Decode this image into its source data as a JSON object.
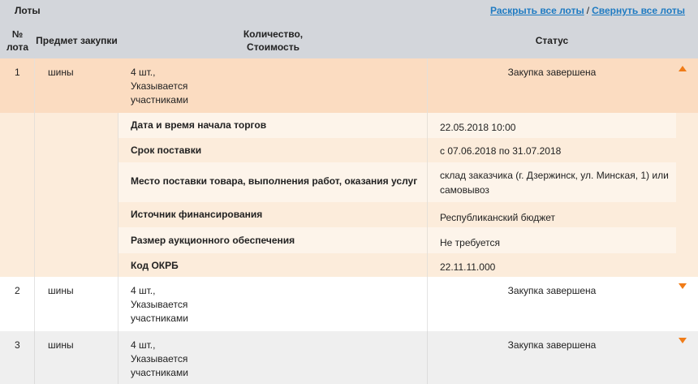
{
  "header": {
    "title": "Лоты",
    "expand_all": "Раскрыть все лоты",
    "separator": "/",
    "collapse_all": "Свернуть все лоты"
  },
  "columns": {
    "num_line1": "№",
    "num_line2": "лота",
    "subject": "Предмет закупки",
    "qty_line1": "Количество,",
    "qty_line2": "Стоимость",
    "status": "Статус"
  },
  "lots": [
    {
      "num": "1",
      "subject": "шины",
      "qty_line1": "4 шт.,",
      "qty_line2": "Указывается",
      "qty_line3": "участниками",
      "status": "Закупка завершена",
      "expanded": true
    },
    {
      "num": "2",
      "subject": "шины",
      "qty_line1": "4 шт.,",
      "qty_line2": "Указывается",
      "qty_line3": "участниками",
      "status": "Закупка завершена",
      "expanded": false
    },
    {
      "num": "3",
      "subject": "шины",
      "qty_line1": "4 шт.,",
      "qty_line2": "Указывается",
      "qty_line3": "участниками",
      "status": "Закупка завершена",
      "expanded": false
    }
  ],
  "details": [
    {
      "label": "Дата и время начала торгов",
      "value": "22.05.2018 10:00"
    },
    {
      "label": "Срок поставки",
      "value": "с 07.06.2018 по 31.07.2018"
    },
    {
      "label": "Место поставки товара, выполнения работ, оказания услуг",
      "value": "склад заказчика (г. Дзержинск, ул. Минская, 1) или самовывоз"
    },
    {
      "label": "Источник финансирования",
      "value": "Республиканский бюджет"
    },
    {
      "label": "Размер аукционного обеспечения",
      "value": "Не требуется"
    },
    {
      "label": "Код ОКРБ",
      "value": "22.11.11.000"
    }
  ],
  "colors": {
    "accent": "#f07c18",
    "link": "#1f7bc2",
    "header_bg": "#d3d6db",
    "expanded_row_bg": "#fbdcc1",
    "detail_bg_a": "#fdf4ea",
    "detail_bg_b": "#fcecdb",
    "zebra_bg": "#efefef"
  }
}
